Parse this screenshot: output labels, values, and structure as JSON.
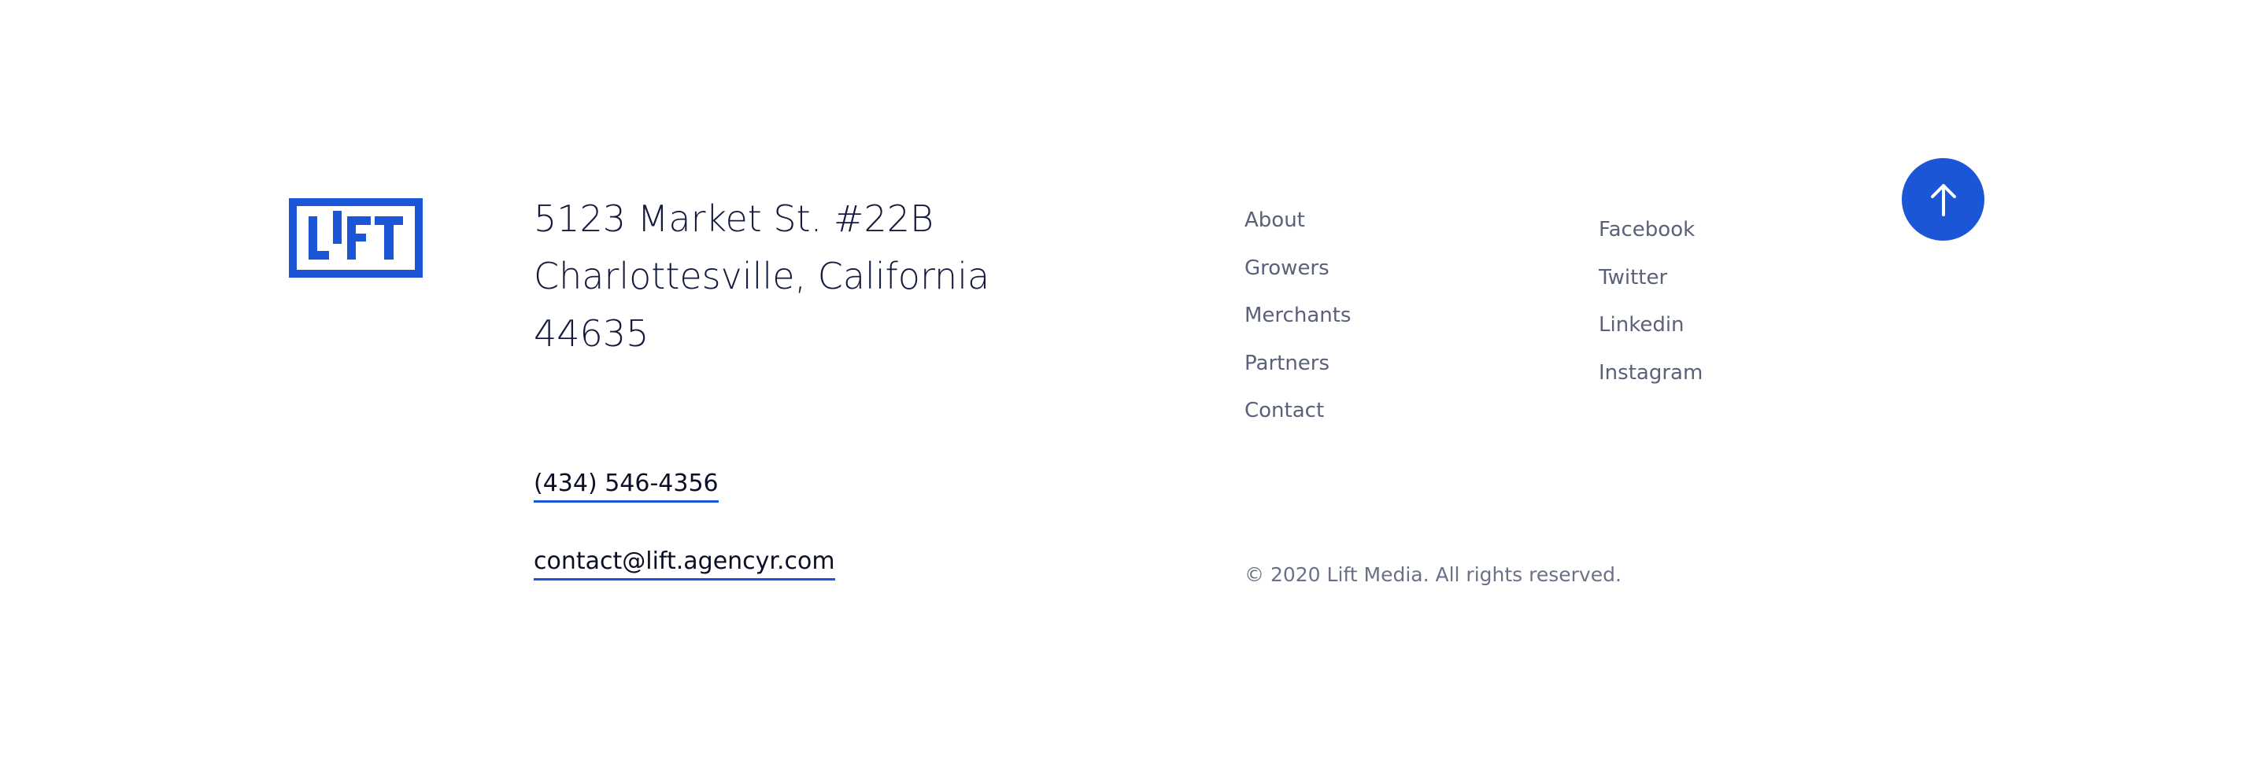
{
  "brand": {
    "logo_text": "LIFT",
    "accent_color": "#1a56d6"
  },
  "address": {
    "line1": "5123 Market St. #22B",
    "line2": "Charlottesville, California",
    "line3": "44635"
  },
  "contact": {
    "phone": "(434) 546-4356",
    "email": "contact@lift.agencyr.com"
  },
  "nav": {
    "items": [
      {
        "label": "About"
      },
      {
        "label": "Growers"
      },
      {
        "label": "Merchants"
      },
      {
        "label": "Partners"
      },
      {
        "label": "Contact"
      }
    ]
  },
  "social": {
    "items": [
      {
        "label": "Facebook"
      },
      {
        "label": "Twitter"
      },
      {
        "label": "Linkedin"
      },
      {
        "label": "Instagram"
      }
    ]
  },
  "copyright": "© 2020 Lift Media. All rights reserved.",
  "back_to_top": {
    "icon": "arrow-up-icon"
  }
}
